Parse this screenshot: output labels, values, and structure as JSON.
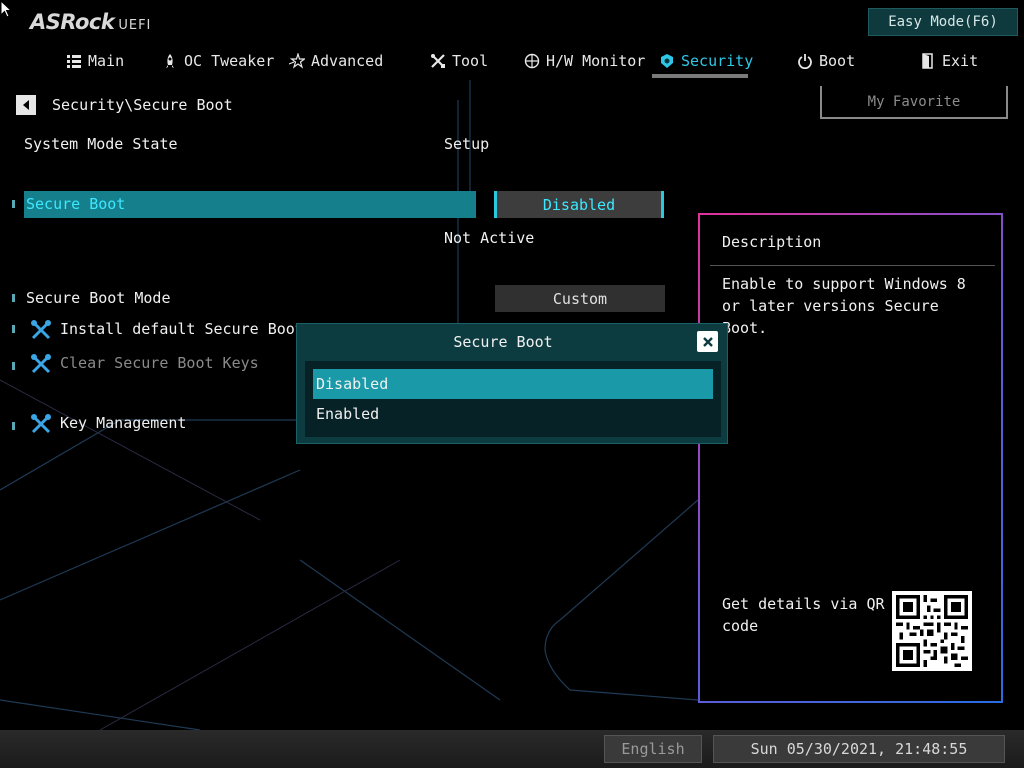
{
  "header": {
    "brand": "ASRock",
    "brand_sub": "UEFI",
    "easy_mode": "Easy Mode(F6)"
  },
  "tabs": [
    {
      "label": "Main",
      "icon": "list-icon"
    },
    {
      "label": "OC Tweaker",
      "icon": "rocket-icon"
    },
    {
      "label": "Advanced",
      "icon": "star-icon"
    },
    {
      "label": "Tool",
      "icon": "tools-icon"
    },
    {
      "label": "H/W Monitor",
      "icon": "monitor-icon"
    },
    {
      "label": "Security",
      "icon": "shield-icon",
      "active": true
    },
    {
      "label": "Boot",
      "icon": "power-icon"
    },
    {
      "label": "Exit",
      "icon": "exit-door-icon"
    }
  ],
  "breadcrumb": "Security\\Secure Boot",
  "my_favorite": "My Favorite",
  "settings": {
    "system_mode_label": "System Mode State",
    "system_mode_value": "Setup",
    "secure_boot_label": "Secure Boot",
    "secure_boot_value": "Disabled",
    "secure_boot_status": "Not Active",
    "secure_boot_mode_label": "Secure Boot Mode",
    "secure_boot_mode_value": "Custom",
    "install_keys_label": "Install default Secure Boot Keys",
    "clear_keys_label": "Clear Secure Boot Keys",
    "key_management_label": "Key Management"
  },
  "description": {
    "title": "Description",
    "text": "Enable to support Windows 8 or later versions Secure Boot.",
    "qr_text": "Get details via QR code"
  },
  "popup": {
    "title": "Secure Boot",
    "options": [
      "Disabled",
      "Enabled"
    ],
    "selected": "Disabled"
  },
  "footer": {
    "language": "English",
    "datetime": "Sun 05/30/2021, 21:48:55"
  },
  "colors": {
    "accent": "#2ec8e6",
    "selection": "#167f8c",
    "popup_bg": "#0d3c40"
  }
}
